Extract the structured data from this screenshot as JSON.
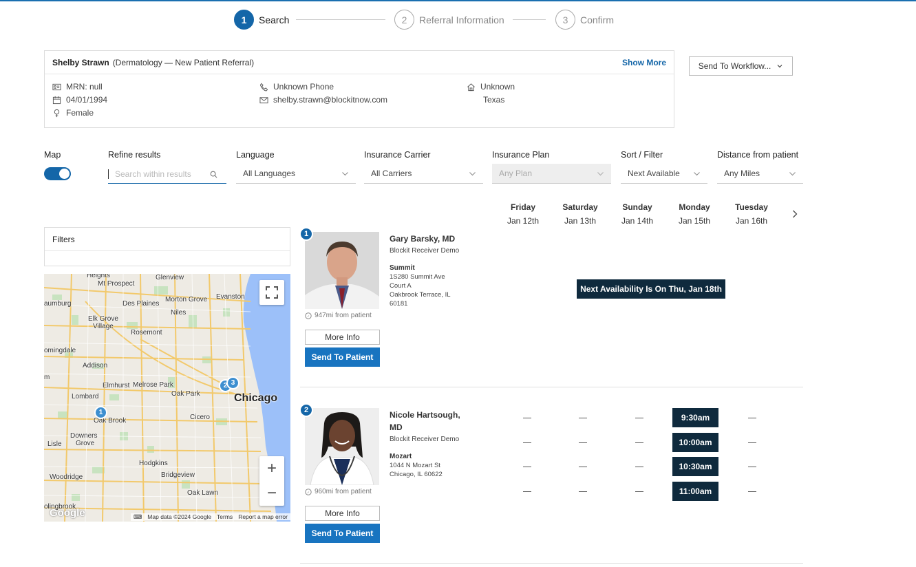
{
  "stepper": {
    "steps": [
      {
        "num": "1",
        "label": "Search"
      },
      {
        "num": "2",
        "label": "Referral Information"
      },
      {
        "num": "3",
        "label": "Confirm"
      }
    ]
  },
  "patient": {
    "name": "Shelby Strawn",
    "referral": "(Dermatology — New Patient Referral)",
    "show_more": "Show More",
    "mrn": "MRN: null",
    "dob": "04/01/1994",
    "gender": "Female",
    "phone": "Unknown Phone",
    "email": "shelby.strawn@blockitnow.com",
    "address_line1": "Unknown",
    "address_line2": "Texas"
  },
  "workflow_button": "Send To Workflow...",
  "filters": {
    "map_label": "Map",
    "refine_label": "Refine results",
    "search_placeholder": "Search within results",
    "language_label": "Language",
    "language_value": "All Languages",
    "carrier_label": "Insurance Carrier",
    "carrier_value": "All Carriers",
    "plan_label": "Insurance Plan",
    "plan_value": "Any Plan",
    "sort_label": "Sort / Filter",
    "sort_value": "Next Available",
    "distance_label": "Distance from patient",
    "distance_value": "Any Miles"
  },
  "days": [
    {
      "name": "Friday",
      "date": "Jan 12th"
    },
    {
      "name": "Saturday",
      "date": "Jan 13th"
    },
    {
      "name": "Sunday",
      "date": "Jan 14th"
    },
    {
      "name": "Monday",
      "date": "Jan 15th"
    },
    {
      "name": "Tuesday",
      "date": "Jan 16th"
    }
  ],
  "filters_panel_title": "Filters",
  "map": {
    "labels": [
      "Heights",
      "Mt Prospect",
      "Glenview",
      "aumburg",
      "Des Plaines",
      "Morton Grove",
      "Evanston",
      "Niles",
      "Elk Grove",
      "Village",
      "Rosemont",
      "omingdale",
      "Addison",
      "Elmhurst",
      "Melrose Park",
      "m",
      "Lombard",
      "Oak Park",
      "Chicago",
      "Oak Brook",
      "Cicero",
      "Downers",
      "Grove",
      "Lisle",
      "Hodgkins",
      "Woodridge",
      "Bridgeview",
      "Oak Lawn",
      "olingbrook"
    ],
    "google": "Google",
    "attribution": "Map data ©2024 Google",
    "terms": "Terms",
    "report": "Report a map error",
    "markers": [
      "1",
      "2",
      "3"
    ]
  },
  "providers": [
    {
      "num": "1",
      "name": "Gary Barsky, MD",
      "org": "Blockit Receiver Demo",
      "location": "Summit",
      "address": [
        "1S280 Summit Ave",
        "Court A",
        "Oakbrook Terrace, IL",
        "60181"
      ],
      "distance": "947mi from patient",
      "more_info": "More Info",
      "send": "Send To Patient",
      "next_availability": "Next Availability Is On Thu, Jan 18th"
    },
    {
      "num": "2",
      "name_line1": "Nicole Hartsough,",
      "name_line2": "MD",
      "org": "Blockit Receiver Demo",
      "location": "Mozart",
      "address": [
        "1044 N Mozart St",
        "Chicago, IL 60622"
      ],
      "distance": "960mi from patient",
      "more_info": "More Info",
      "send": "Send To Patient",
      "slots": [
        "9:30am",
        "10:00am",
        "10:30am",
        "11:00am"
      ]
    }
  ],
  "colors": {
    "primary": "#1466a8",
    "button": "#1874c0",
    "dark_slot": "#0f2a3d"
  }
}
